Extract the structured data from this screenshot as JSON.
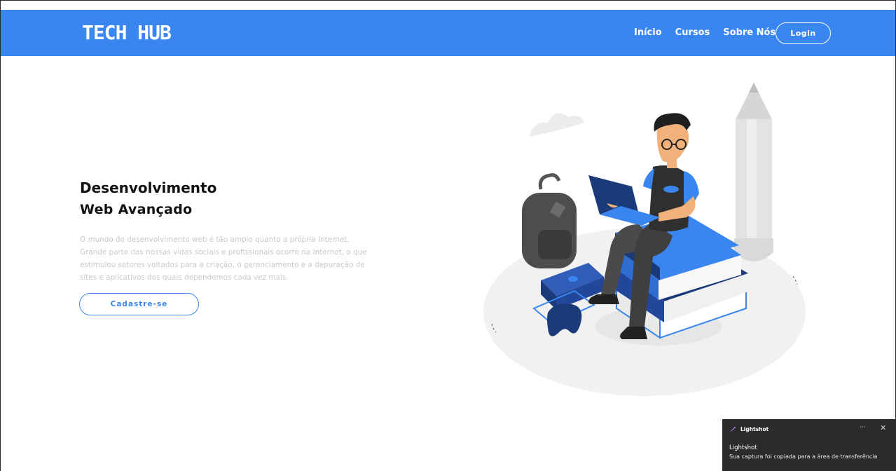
{
  "header": {
    "logo": "TECH HUB",
    "nav": [
      "Início",
      "Cursos",
      "Sobre Nós"
    ],
    "login_label": "Login"
  },
  "hero": {
    "title": "Desenvolvimento",
    "subtitle": "Web Avançado",
    "paragraph": "O mundo do desenvolvimento web é tão amplo quanto a própria Internet. Grande parte das nossas vidas sociais e profissionais ocorre na Internet, o que estimulou setores voltados para a criação, o gerenciamento e a depuração de sites e aplicativos dos quais dependemos cada vez mais.",
    "cta_label": "Cadastre-se"
  },
  "notification": {
    "app": "Lightshot",
    "title": "Lightshot",
    "message": "Sua captura foi copiada para a área de transferência",
    "more": "···",
    "close": "✕"
  },
  "colors": {
    "brand": "#3a86f0",
    "dark_blue": "#1b3a7a",
    "toast_bg": "#2b2b2b"
  }
}
